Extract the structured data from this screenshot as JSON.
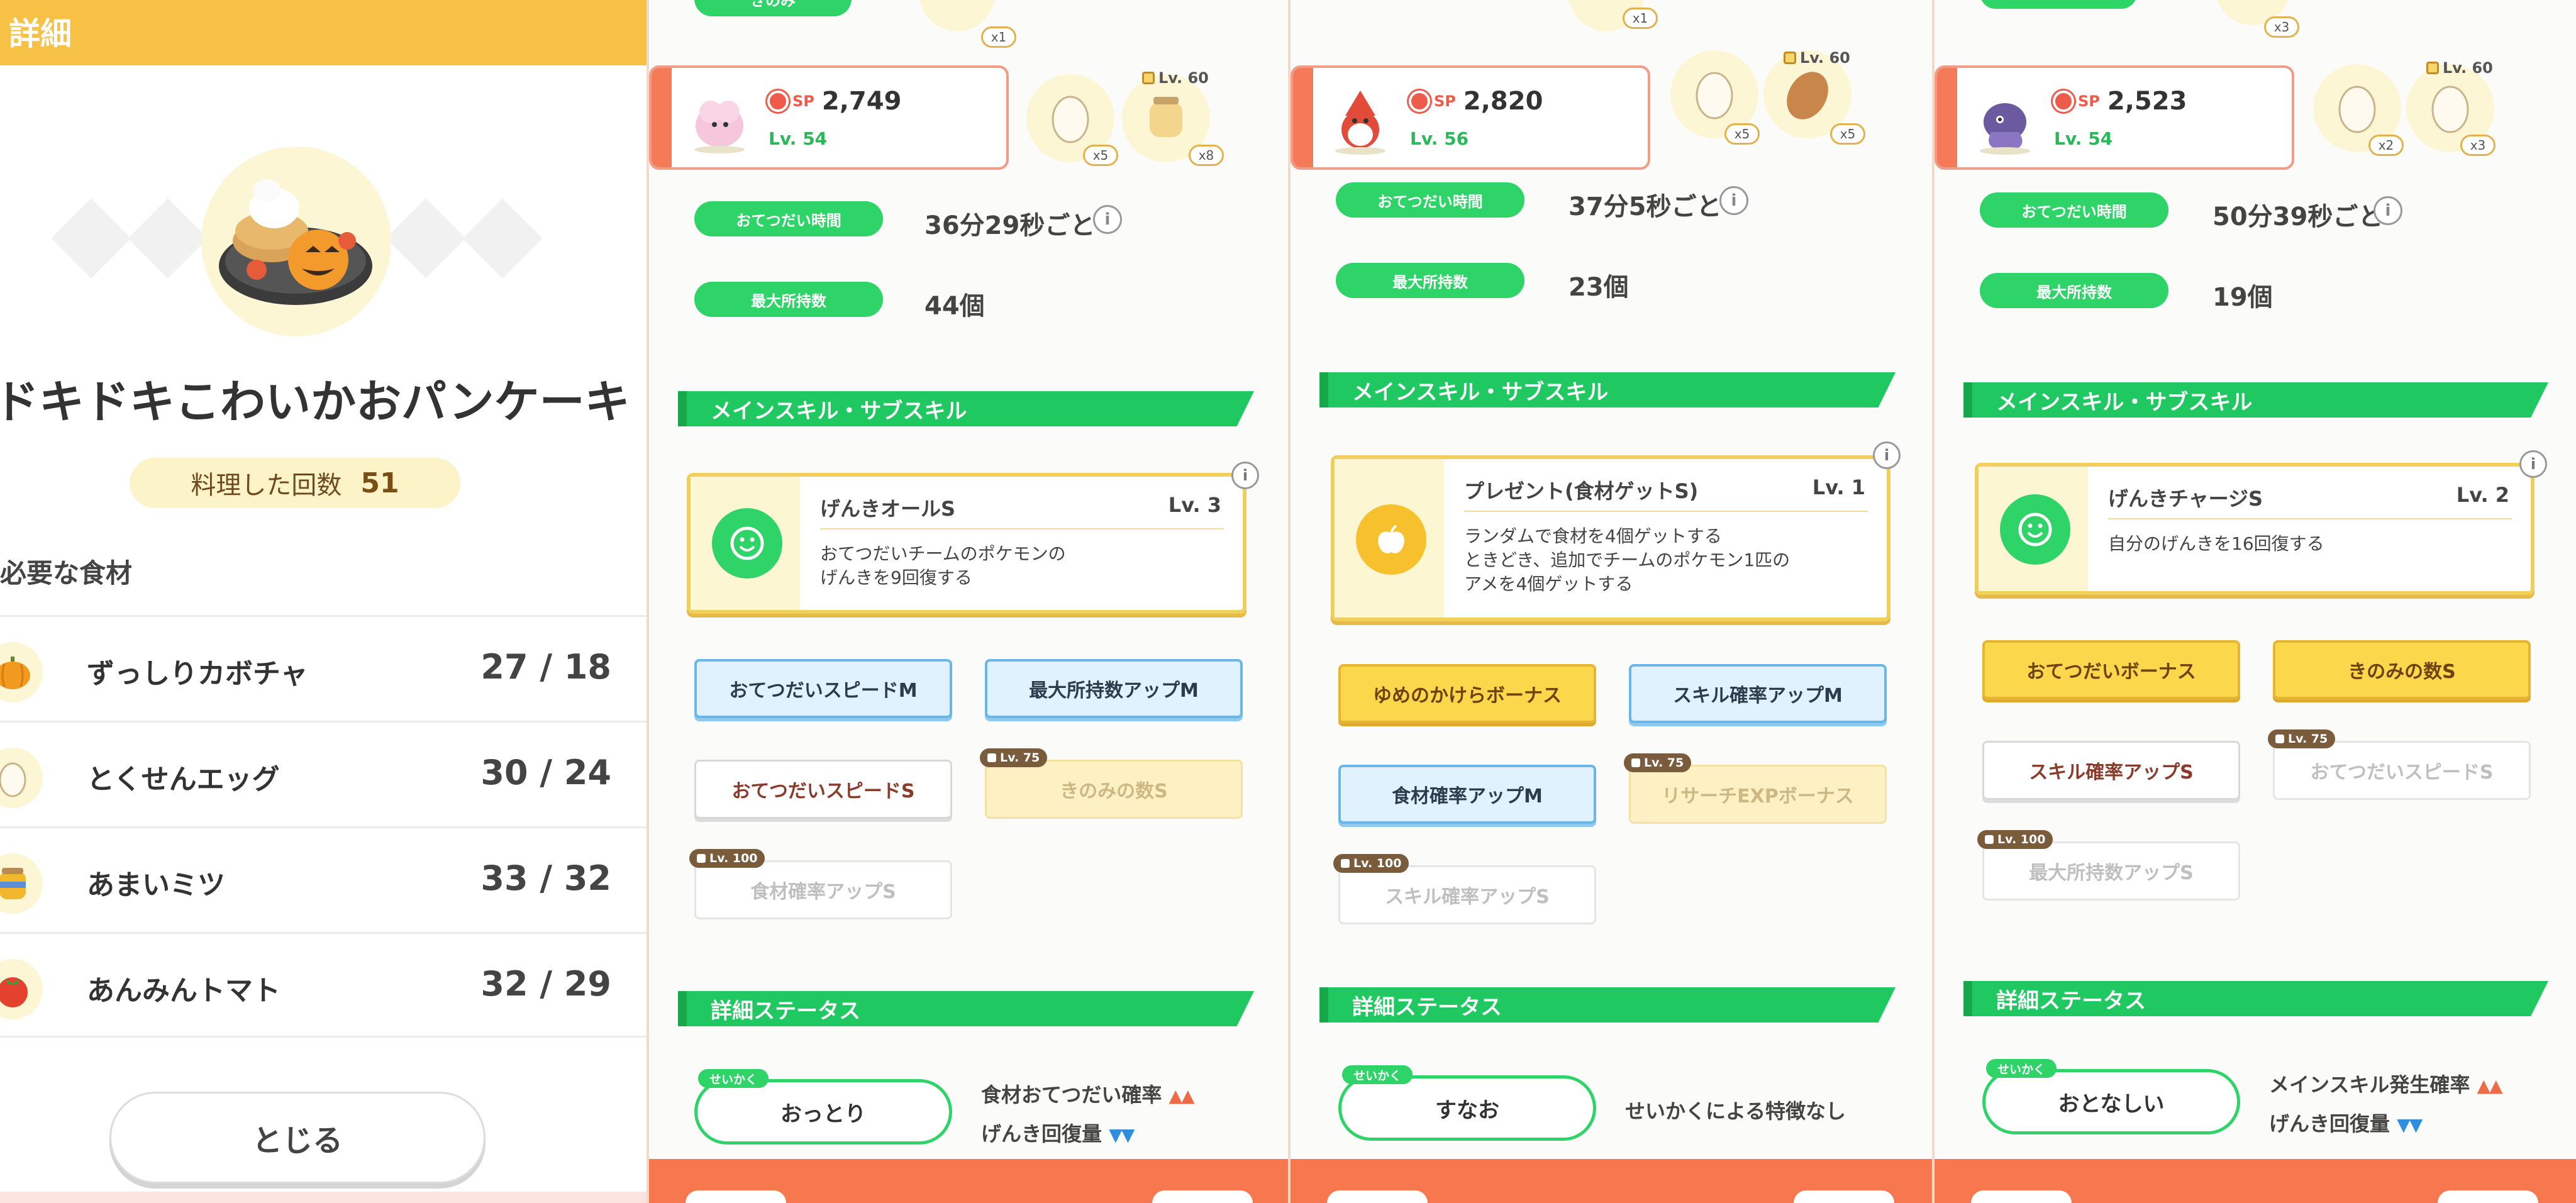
{
  "recipe": {
    "header_title": "詳細",
    "name": "ドキドキこわいかおパンケーキ",
    "cooked_label": "料理した回数",
    "cooked_count": "51",
    "required_title": "必要な食材",
    "ingredients": [
      {
        "name": "ずっしりカボチャ",
        "count": "27 / 18",
        "icon": "pumpkin-icon"
      },
      {
        "name": "とくせんエッグ",
        "count": "30 / 24",
        "icon": "egg-icon"
      },
      {
        "name": "あまいミツ",
        "count": "33 / 32",
        "icon": "honey-icon"
      },
      {
        "name": "あんみんトマト",
        "count": "32 / 29",
        "icon": "tomato-icon"
      }
    ],
    "close_label": "とじる"
  },
  "labels": {
    "sp": "SP",
    "help_time": "おてつだい時間",
    "max_carry": "最大所持数",
    "skills_section": "メインスキル・サブスキル",
    "detail_section": "詳細ステータス",
    "nature_tag": "せいかく",
    "info": "i"
  },
  "pokemon": [
    {
      "top_berry": "きのみ",
      "top_x": "x1",
      "sp": "2,749",
      "level": "Lv. 54",
      "slots": [
        {
          "count": "x5"
        },
        {
          "count": "x8"
        }
      ],
      "lock_level": "Lv. 60",
      "help_time": "36分29秒ごと",
      "max_carry": "44個",
      "main_skill": {
        "name": "げんきオールS",
        "level": "Lv. 3",
        "desc": "おてつだいチームのポケモンの\nげんきを9回復する",
        "icon": "smile-icon",
        "color": "#2ed468"
      },
      "subs": [
        {
          "label": "おてつだいスピードM",
          "style": "blue",
          "lock": ""
        },
        {
          "label": "最大所持数アップM",
          "style": "blue",
          "lock": ""
        },
        {
          "label": "おてつだいスピードS",
          "style": "white",
          "lock": ""
        },
        {
          "label": "きのみの数S",
          "style": "faintgold",
          "lock": "Lv. 75"
        },
        {
          "label": "食材確率アップS",
          "style": "faint",
          "lock": "Lv. 100"
        }
      ],
      "nature": "おっとり",
      "nature_up": "食材おてつだい確率",
      "nature_down": "げんき回復量",
      "up_arrows": "▲▲",
      "down_arrows": "▼▼"
    },
    {
      "top_berry": "",
      "top_x": "x1",
      "sp": "2,820",
      "level": "Lv. 56",
      "slots": [
        {
          "count": "x5"
        },
        {
          "count": "x5"
        }
      ],
      "lock_level": "Lv. 60",
      "help_time": "37分5秒ごと",
      "max_carry": "23個",
      "main_skill": {
        "name": "プレゼント(食材ゲットS)",
        "level": "Lv. 1",
        "desc": "ランダムで食材を4個ゲットする\nときどき、追加でチームのポケモン1匹の\nアメを4個ゲットする",
        "icon": "apple-icon",
        "color": "#f7c12e"
      },
      "subs": [
        {
          "label": "ゆめのかけらボーナス",
          "style": "gold",
          "lock": ""
        },
        {
          "label": "スキル確率アップM",
          "style": "blue",
          "lock": ""
        },
        {
          "label": "食材確率アップM",
          "style": "blue",
          "lock": ""
        },
        {
          "label": "リサーチEXPボーナス",
          "style": "faintgold",
          "lock": "Lv. 75"
        },
        {
          "label": "スキル確率アップS",
          "style": "faint",
          "lock": "Lv. 100"
        }
      ],
      "nature": "すなお",
      "nature_up": "せいかくによる特徴なし",
      "nature_down": "",
      "up_arrows": "",
      "down_arrows": ""
    },
    {
      "top_berry": "",
      "top_x": "x3",
      "sp": "2,523",
      "level": "Lv. 54",
      "slots": [
        {
          "count": "x2"
        },
        {
          "count": "x3"
        }
      ],
      "lock_level": "Lv. 60",
      "help_time": "50分39秒ごと",
      "max_carry": "19個",
      "main_skill": {
        "name": "げんきチャージS",
        "level": "Lv. 2",
        "desc": "自分のげんきを16回復する",
        "icon": "smile-icon",
        "color": "#2ed468"
      },
      "subs": [
        {
          "label": "おてつだいボーナス",
          "style": "gold",
          "lock": ""
        },
        {
          "label": "きのみの数S",
          "style": "gold",
          "lock": ""
        },
        {
          "label": "スキル確率アップS",
          "style": "white",
          "lock": ""
        },
        {
          "label": "おてつだいスピードS",
          "style": "faint",
          "lock": "Lv. 75"
        },
        {
          "label": "最大所持数アップS",
          "style": "faint",
          "lock": "Lv. 100"
        }
      ],
      "nature": "おとなしい",
      "nature_up": "メインスキル発生確率",
      "nature_down": "げんき回復量",
      "up_arrows": "▲▲",
      "down_arrows": "▼▼"
    }
  ]
}
